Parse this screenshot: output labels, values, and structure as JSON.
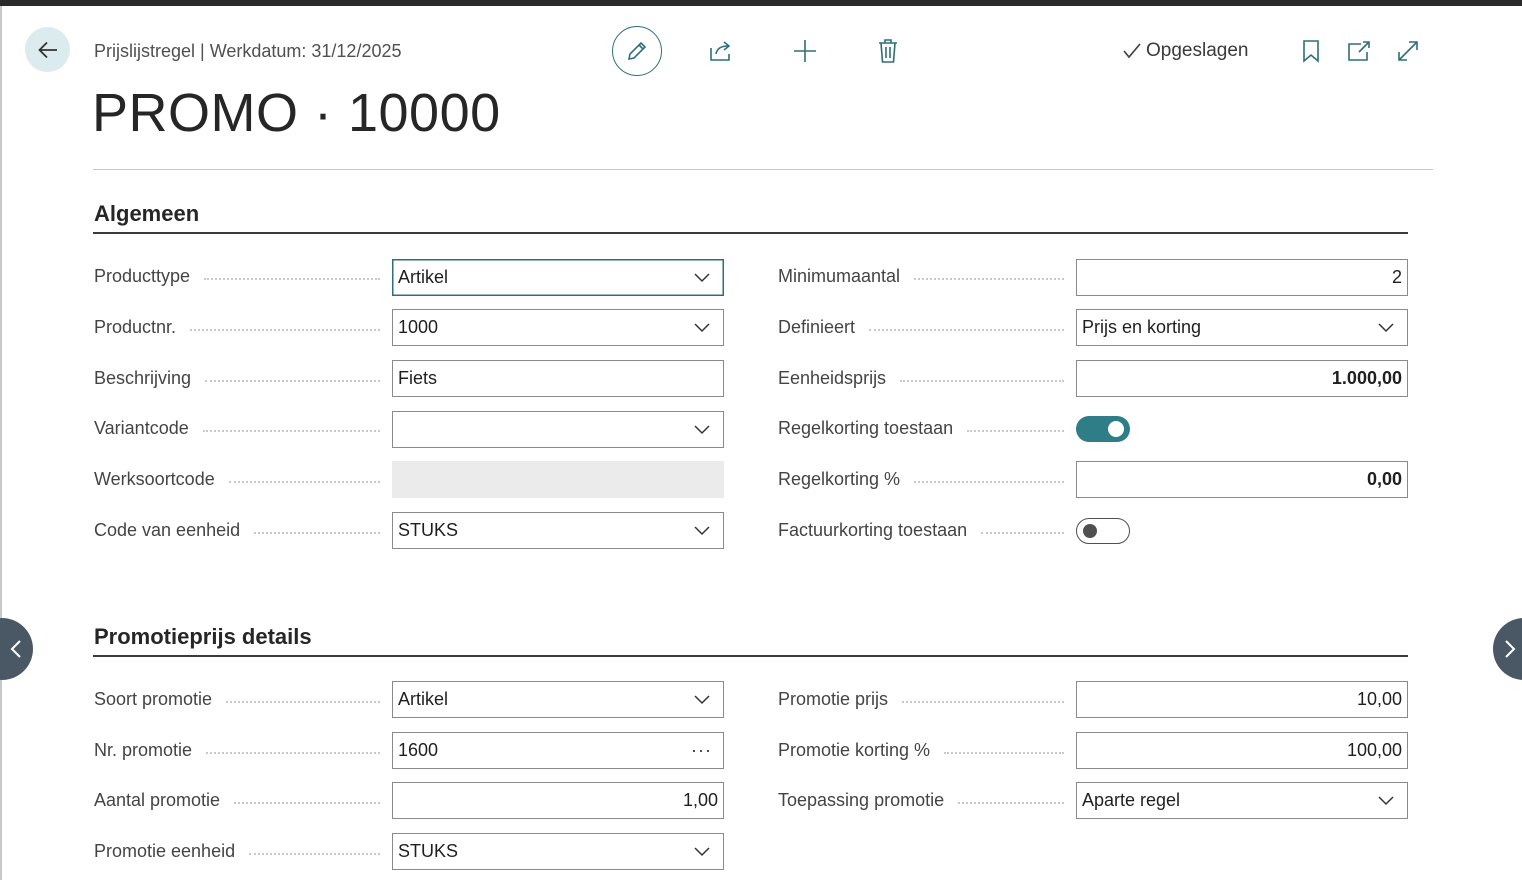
{
  "header": {
    "breadcrumb": "Prijslijstregel | Werkdatum: 31/12/2025",
    "status": "Opgeslagen",
    "title": "PROMO · 10000"
  },
  "toolbar": {
    "icons": [
      "back-arrow-icon",
      "pencil-icon",
      "share-icon",
      "plus-icon",
      "trash-icon",
      "checkmark-icon",
      "bookmark-icon",
      "open-new-window-icon",
      "expand-icon"
    ]
  },
  "sections": {
    "general": {
      "title": "Algemeen",
      "left": [
        {
          "label": "Producttype",
          "value": "Artikel"
        },
        {
          "label": "Productnr.",
          "value": "1000"
        },
        {
          "label": "Beschrijving",
          "value": "Fiets"
        },
        {
          "label": "Variantcode",
          "value": ""
        },
        {
          "label": "Werksoortcode",
          "value": ""
        },
        {
          "label": "Code van eenheid",
          "value": "STUKS"
        }
      ],
      "right": [
        {
          "label": "Minimumaantal",
          "value": "2"
        },
        {
          "label": "Definieert",
          "value": "Prijs en korting"
        },
        {
          "label": "Eenheidsprijs",
          "value": "1.000,00"
        },
        {
          "label": "Regelkorting toestaan",
          "value": true
        },
        {
          "label": "Regelkorting %",
          "value": "0,00"
        },
        {
          "label": "Factuurkorting toestaan",
          "value": false
        }
      ]
    },
    "promo": {
      "title": "Promotieprijs details",
      "left": [
        {
          "label": "Soort promotie",
          "value": "Artikel"
        },
        {
          "label": "Nr. promotie",
          "value": "1600"
        },
        {
          "label": "Aantal promotie",
          "value": "1,00"
        },
        {
          "label": "Promotie eenheid",
          "value": "STUKS"
        }
      ],
      "right": [
        {
          "label": "Promotie prijs",
          "value": "10,00"
        },
        {
          "label": "Promotie korting %",
          "value": "100,00"
        },
        {
          "label": "Toepassing promotie",
          "value": "Aparte regel"
        }
      ]
    }
  },
  "colors": {
    "accent": "#2f7d86",
    "toggle_on": "#2f7d86",
    "nav_button": "#4a5866"
  }
}
